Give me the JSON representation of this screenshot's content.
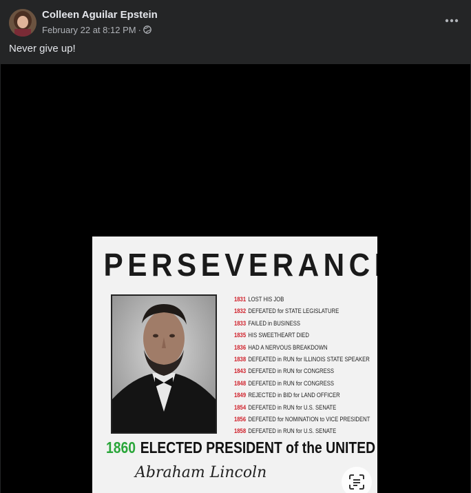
{
  "post": {
    "author": "Colleen Aguilar Epstein",
    "timestamp": "February 22 at 8:12 PM",
    "separator": "·",
    "privacy_icon": "globe-icon",
    "text": "Never give up!",
    "more_icon": "more-options-icon"
  },
  "poster": {
    "title": "PERSEVERANCE",
    "timeline": [
      {
        "year": "1831",
        "event": "LOST HIS JOB"
      },
      {
        "year": "1832",
        "event": "DEFEATED for STATE LEGISLATURE"
      },
      {
        "year": "1833",
        "event": "FAILED in BUSINESS"
      },
      {
        "year": "1835",
        "event": "HIS SWEETHEART DIED"
      },
      {
        "year": "1836",
        "event": "HAD A NERVOUS BREAKDOWN"
      },
      {
        "year": "1838",
        "event": "DEFEATED in RUN for ILLINOIS STATE SPEAKER"
      },
      {
        "year": "1843",
        "event": "DEFEATED in RUN for CONGRESS"
      },
      {
        "year": "1848",
        "event": "DEFEATED in RUN for CONGRESS"
      },
      {
        "year": "1849",
        "event": "REJECTED in BID for LAND OFFICER"
      },
      {
        "year": "1854",
        "event": "DEFEATED in RUN for U.S. SENATE"
      },
      {
        "year": "1856",
        "event": "DEFEATED for NOMINATION to VICE PRESIDENT"
      },
      {
        "year": "1858",
        "event": "DEFEATED in RUN for U.S. SENATE"
      }
    ],
    "elected_year": "1860",
    "elected_text": "ELECTED PRESIDENT of the UNITED STATES",
    "signature": "Abraham Lincoln"
  },
  "colors": {
    "background": "#242526",
    "media_background": "#000000",
    "year_red": "#d0202a",
    "year_green": "#2aa63a"
  }
}
